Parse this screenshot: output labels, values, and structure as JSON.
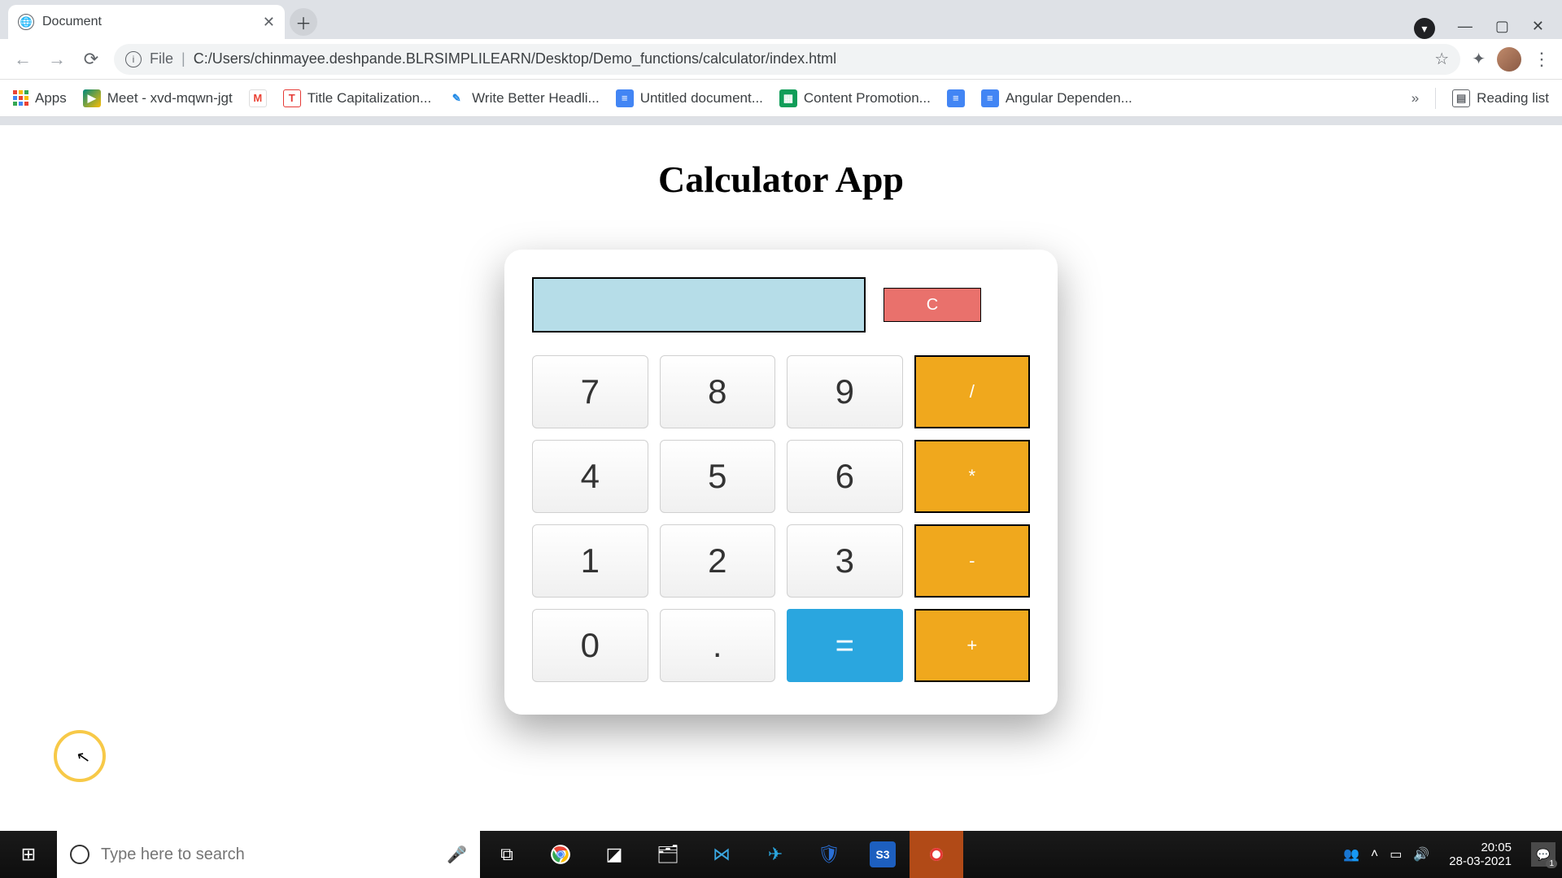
{
  "browser": {
    "tab_title": "Document",
    "url_scheme": "File",
    "url_path": "C:/Users/chinmayee.deshpande.BLRSIMPLILEARN/Desktop/Demo_functions/calculator/index.html",
    "bookmarks": {
      "apps": "Apps",
      "meet": "Meet - xvd-mqwn-jgt",
      "title_cap": "Title Capitalization...",
      "headlines": "Write Better Headli...",
      "untitled": "Untitled document...",
      "promotion": "Content Promotion...",
      "angular": "Angular Dependen...",
      "overflow": "»",
      "reading_list": "Reading list"
    }
  },
  "page": {
    "heading": "Calculator App",
    "display_value": "",
    "clear": "C",
    "keys": {
      "k7": "7",
      "k8": "8",
      "k9": "9",
      "div": "/",
      "k4": "4",
      "k5": "5",
      "k6": "6",
      "mul": "*",
      "k1": "1",
      "k2": "2",
      "k3": "3",
      "sub": "-",
      "k0": "0",
      "dot": ".",
      "eq": "=",
      "add": "+"
    }
  },
  "taskbar": {
    "search_placeholder": "Type here to search",
    "time": "20:05",
    "date": "28-03-2021",
    "notif_count": "1"
  }
}
